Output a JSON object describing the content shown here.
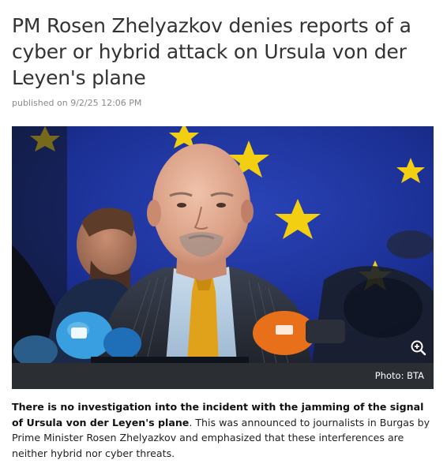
{
  "article": {
    "headline": "PM Rosen Zhelyazkov denies reports of a cyber or hybrid attack on Ursula von der Leyen's plane",
    "published": "published on 9/2/25 12:06 PM",
    "photo_credit": "Photo: BTA",
    "lead_bold": "There is no investigation into the incident with the jamming of the signal of Ursula von der Leyen's plane",
    "lead_text": ". This was announced to journalists in Burgas by Prime Minister Rosen Zhelyazkov and emphasized that these interferences are neither hybrid nor cyber threats."
  },
  "icons": {
    "zoom": "zoom-in-icon"
  },
  "colors": {
    "eu_blue": "#1d2f8f",
    "star_yellow": "#f5d000",
    "caption_bar": "#2b2e33",
    "tie_yellow": "#e0a21a",
    "mic_orange": "#e8701a",
    "mic_blue": "#3a9fe0"
  }
}
